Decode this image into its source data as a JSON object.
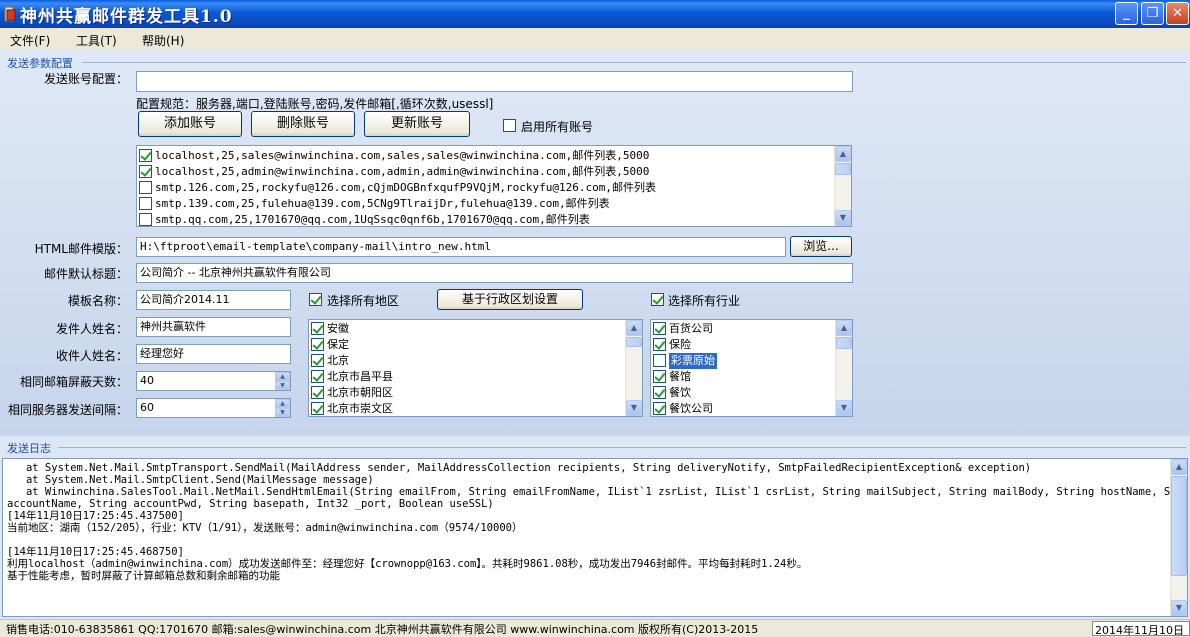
{
  "window": {
    "title": "神州共赢邮件群发工具1.0",
    "minimize_glyph": "_",
    "restore_glyph": "❐",
    "close_glyph": "✕"
  },
  "menu": [
    "文件(F)",
    "工具(T)",
    "帮助(H)"
  ],
  "send_config": {
    "legend": "发送参数配置",
    "account_config_label": "发送账号配置：",
    "account_config_value": "",
    "format_hint": "配置规范：服务器,端口,登陆账号,密码,发件邮箱[,循环次数,usessl]",
    "add_button": "添加账号",
    "delete_button": "删除账号",
    "update_button": "更新账号",
    "enable_all_label": "启用所有账号",
    "enable_all_checked": false,
    "accounts": [
      {
        "text": "localhost,25,sales@winwinchina.com,sales,sales@winwinchina.com,邮件列表,5000",
        "checked": true
      },
      {
        "text": "localhost,25,admin@winwinchina.com,admin,admin@winwinchina.com,邮件列表,5000",
        "checked": true
      },
      {
        "text": "smtp.126.com,25,rockyfu@126.com,cQjmDOGBnfxqufP9VQjM,rockyfu@126.com,邮件列表",
        "checked": false
      },
      {
        "text": "smtp.139.com,25,fulehua@139.com,5CNg9TlraijDr,fulehua@139.com,邮件列表",
        "checked": false
      },
      {
        "text": "smtp.qq.com,25,1701670@qq.com,1UqSsqc0qnf6b,1701670@qq.com,邮件列表",
        "checked": false
      }
    ],
    "html_template_label": "HTML邮件模版：",
    "html_template_value": "H:\\ftproot\\email-template\\company-mail\\intro_new.html",
    "browse_button": "浏览...",
    "default_subject_label": "邮件默认标题：",
    "default_subject_value": "公司简介 -- 北京神州共赢软件有限公司",
    "template_name_label": "模板名称：",
    "template_name_value": "公司简介2014.11",
    "sender_name_label": "发件人姓名：",
    "sender_name_value": "神州共赢软件",
    "recipient_name_label": "收件人姓名：",
    "recipient_name_value": "经理您好",
    "block_days_label": "相同邮箱屏蔽天数：",
    "block_days_value": "40",
    "interval_label": "相同服务器发送间隔：",
    "interval_value": "60",
    "select_all_regions_label": "选择所有地区",
    "select_all_regions_checked": true,
    "region_settings_button": "基于行政区划设置",
    "select_all_industries_label": "选择所有行业",
    "select_all_industries_checked": true,
    "regions": [
      {
        "text": "安徽",
        "checked": true
      },
      {
        "text": "保定",
        "checked": true
      },
      {
        "text": "北京",
        "checked": true
      },
      {
        "text": "北京市昌平县",
        "checked": true
      },
      {
        "text": "北京市朝阳区",
        "checked": true
      },
      {
        "text": "北京市崇文区",
        "checked": true
      }
    ],
    "industries": [
      {
        "text": "百货公司",
        "checked": true,
        "selected": false
      },
      {
        "text": "保险",
        "checked": true,
        "selected": false
      },
      {
        "text": "彩票原始",
        "checked": false,
        "selected": true
      },
      {
        "text": "餐馆",
        "checked": true,
        "selected": false
      },
      {
        "text": "餐饮",
        "checked": true,
        "selected": false
      },
      {
        "text": "餐饮公司",
        "checked": true,
        "selected": false
      }
    ]
  },
  "log": {
    "legend": "发送日志",
    "lines": [
      "   at System.Net.Mail.SmtpTransport.SendMail(MailAddress sender, MailAddressCollection recipients, String deliveryNotify, SmtpFailedRecipientException& exception)",
      "   at System.Net.Mail.SmtpClient.Send(MailMessage message)",
      "   at Winwinchina.SalesTool.Mail.NetMail.SendHtmlEmail(String emailFrom, String emailFromName, IList`1 zsrList, IList`1 csrList, String mailSubject, String mailBody, String hostName, String",
      "accountName, String accountPwd, String basepath, Int32 _port, Boolean useSSL)",
      "[14年11月10日17:25:45.437500]",
      "当前地区：湖南（152/205），行业：KTV（1/91），发送账号：admin@winwinchina.com（9574/10000）",
      "",
      "[14年11月10日17:25:45.468750]",
      "利用localhost（admin@winwinchina.com）成功发送邮件至：经理您好【crownopp@163.com】。共耗时9861.08秒，成功发出7946封邮件。平均每封耗时1.24秒。",
      "基于性能考虑，暂时屏蔽了计算邮箱总数和剩余邮箱的功能"
    ]
  },
  "status": {
    "text": "销售电话:010-63835861 QQ:1701670 邮箱:sales@winwinchina.com 北京神州共赢软件有限公司 www.winwinchina.com 版权所有(C)2013-2015",
    "date": "2014年11月10日"
  },
  "colors": {
    "titlebar": "#0d58d6",
    "panel": "#c6d5ec",
    "legend": "#1f50a8",
    "selection": "#316ac5",
    "check": "#21a121"
  }
}
